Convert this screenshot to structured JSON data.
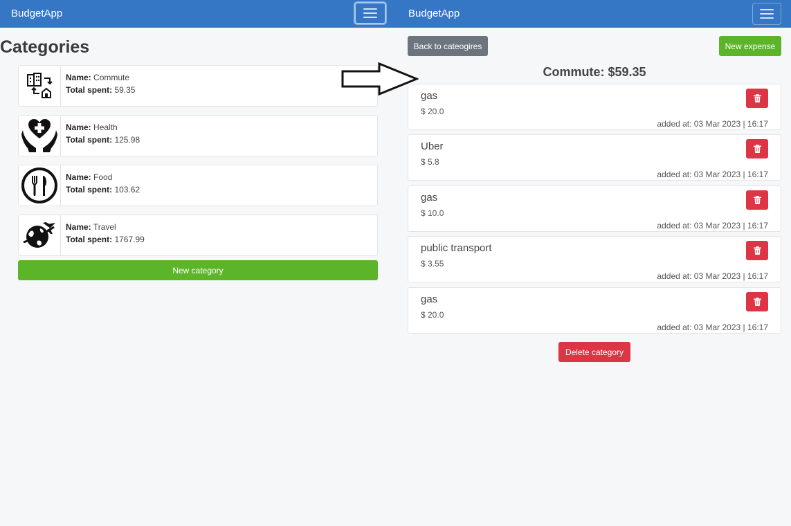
{
  "left_nav": {
    "brand": "BudgetApp",
    "menu_icon": "hamburger-icon"
  },
  "right_nav": {
    "brand": "BudgetApp",
    "menu_icon": "hamburger-icon"
  },
  "categories": {
    "title": "Categories",
    "name_label": "Name:",
    "total_label": "Total spent:",
    "items": [
      {
        "name": "Commute",
        "total": "59.35",
        "icon": "city-commute-icon"
      },
      {
        "name": "Health",
        "total": "125.98",
        "icon": "health-hands-icon"
      },
      {
        "name": "Food",
        "total": "103.62",
        "icon": "fork-knife-icon"
      },
      {
        "name": "Travel",
        "total": "1767.99",
        "icon": "globe-plane-icon"
      }
    ],
    "new_category_label": "New category"
  },
  "detail": {
    "back_label": "Back to cateogires",
    "new_expense_label": "New expense",
    "title": "Commute: $59.35",
    "delete_category_label": "Delete category",
    "expenses": [
      {
        "name": "gas",
        "amount": "$ 20.0",
        "added": "added at: 03 Mar 2023 | 16:17"
      },
      {
        "name": "Uber",
        "amount": "$ 5.8",
        "added": "added at: 03 Mar 2023 | 16:17"
      },
      {
        "name": "gas",
        "amount": "$ 10.0",
        "added": "added at: 03 Mar 2023 | 16:17"
      },
      {
        "name": "public transport",
        "amount": "$ 3.55",
        "added": "added at: 03 Mar 2023 | 16:17"
      },
      {
        "name": "gas",
        "amount": "$ 20.0",
        "added": "added at: 03 Mar 2023 | 16:17"
      }
    ]
  },
  "colors": {
    "navbar": "#3677c5",
    "green": "#5cb529",
    "red": "#dc3545",
    "gray": "#6c757d"
  }
}
